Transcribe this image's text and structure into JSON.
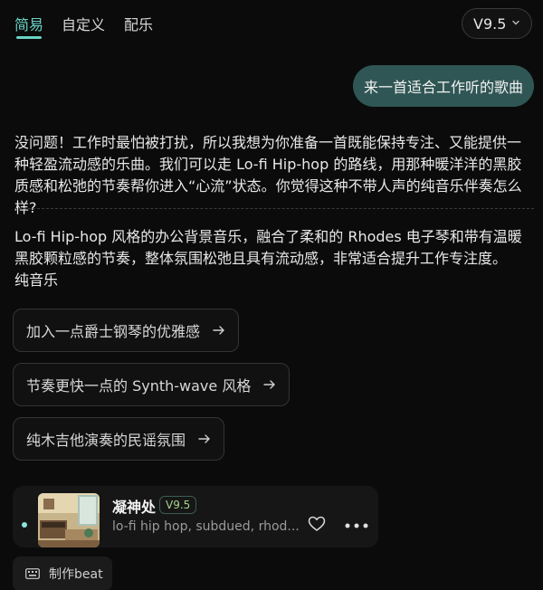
{
  "tabs": [
    {
      "label": "简易",
      "active": true
    },
    {
      "label": "自定义",
      "active": false
    },
    {
      "label": "配乐",
      "active": false
    }
  ],
  "version_selector": {
    "label": "V9.5",
    "icon": "chevron-down-icon"
  },
  "user_message": "来一首适合工作听的歌曲",
  "assistant": {
    "reply": "没问题！工作时最怕被打扰，所以我想为你准备一首既能保持专注、又能提供一种轻盈流动感的乐曲。我们可以走 Lo-fi Hip-hop 的路线，用那种暖洋洋的黑胶质感和松弛的节奏帮你进入“心流”状态。你觉得这种不带人声的纯音乐伴奏怎么样?",
    "description": "Lo-fi Hip-hop 风格的办公背景音乐，融合了柔和的 Rhodes 电子琴和带有温暖黑胶颗粒感的节奏，整体氛围松弛且具有流动感，非常适合提升工作专注度。",
    "genre_note": "纯音乐"
  },
  "suggestions": [
    {
      "label": "加入一点爵士钢琴的优雅感",
      "icon": "arrow-right-icon"
    },
    {
      "label": "节奏更快一点的 Synth-wave 风格",
      "icon": "arrow-right-icon"
    },
    {
      "label": "纯木吉他演奏的民谣氛围",
      "icon": "arrow-right-icon"
    }
  ],
  "song_card": {
    "title": "凝神处",
    "version": "V9.5",
    "tags": "lo-fi hip hop, subdued, rhod...",
    "icons": [
      "heart-icon",
      "more-dots-icon"
    ]
  },
  "make_beat": {
    "label": "制作beat",
    "icon": "keyboard-icon"
  },
  "colors": {
    "accent": "#69d3c3",
    "user_bubble": "#2f5654",
    "background": "#0b0b0b",
    "version_badge_text": "#a8d48d"
  }
}
